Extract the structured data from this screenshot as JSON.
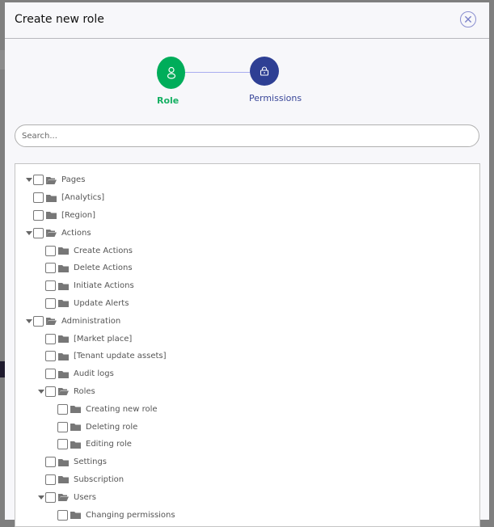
{
  "dialog": {
    "title": "Create new role",
    "close_icon": "close-icon"
  },
  "stepper": {
    "steps": [
      {
        "label": "Role",
        "icon": "user-icon",
        "color": "#00ad5a"
      },
      {
        "label": "Permissions",
        "icon": "lock-icon",
        "color": "#2e3f94"
      }
    ]
  },
  "search": {
    "placeholder": "Search...",
    "value": ""
  },
  "tree": [
    {
      "label": "Pages",
      "level": 0,
      "expanded": true,
      "checked": false
    },
    {
      "label": "[Analytics]",
      "level": 1,
      "expanded": false,
      "checked": false
    },
    {
      "label": "[Region]",
      "level": 1,
      "expanded": false,
      "checked": false
    },
    {
      "label": "Actions",
      "level": 1,
      "expanded": true,
      "checked": false
    },
    {
      "label": "Create Actions",
      "level": 2,
      "expanded": false,
      "checked": false
    },
    {
      "label": "Delete Actions",
      "level": 2,
      "expanded": false,
      "checked": false
    },
    {
      "label": "Initiate Actions",
      "level": 2,
      "expanded": false,
      "checked": false
    },
    {
      "label": "Update Alerts",
      "level": 2,
      "expanded": false,
      "checked": false
    },
    {
      "label": "Administration",
      "level": 1,
      "expanded": true,
      "checked": false
    },
    {
      "label": "[Market place]",
      "level": 2,
      "expanded": false,
      "checked": false
    },
    {
      "label": "[Tenant update assets]",
      "level": 2,
      "expanded": false,
      "checked": false
    },
    {
      "label": "Audit logs",
      "level": 2,
      "expanded": false,
      "checked": false
    },
    {
      "label": "Roles",
      "level": 2,
      "expanded": true,
      "checked": false
    },
    {
      "label": "Creating new role",
      "level": 3,
      "expanded": false,
      "checked": false
    },
    {
      "label": "Deleting role",
      "level": 3,
      "expanded": false,
      "checked": false
    },
    {
      "label": "Editing role",
      "level": 3,
      "expanded": false,
      "checked": false
    },
    {
      "label": "Settings",
      "level": 2,
      "expanded": false,
      "checked": false
    },
    {
      "label": "Subscription",
      "level": 2,
      "expanded": false,
      "checked": false
    },
    {
      "label": "Users",
      "level": 2,
      "expanded": true,
      "checked": false
    },
    {
      "label": "Changing permissions",
      "level": 3,
      "expanded": false,
      "checked": false
    }
  ]
}
